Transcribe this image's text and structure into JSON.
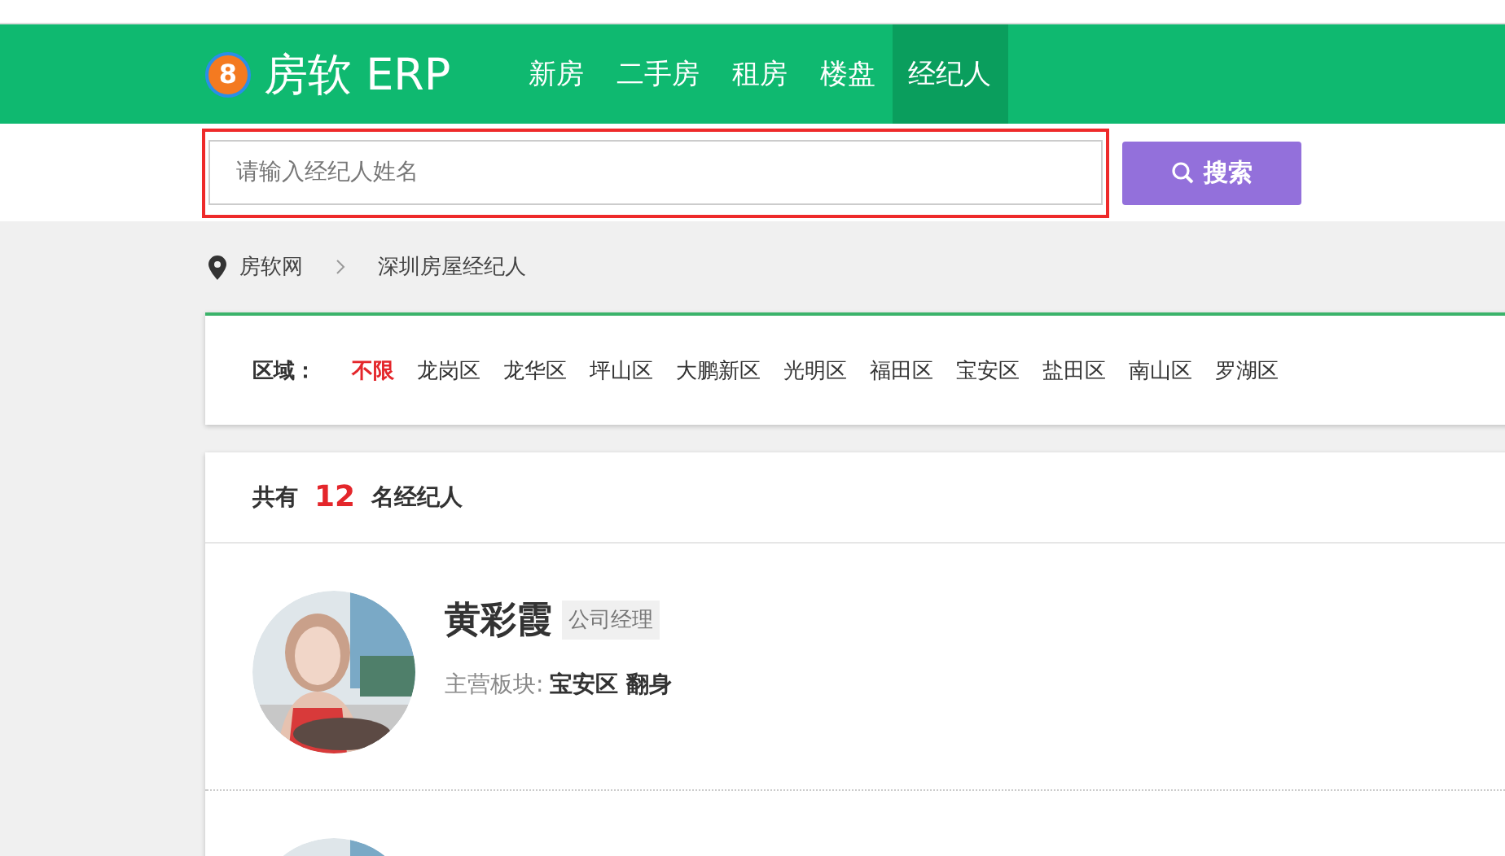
{
  "header": {
    "logo_badge": "8",
    "logo_text": "房软 ERP",
    "nav": [
      {
        "label": "新房",
        "selected": false
      },
      {
        "label": "二手房",
        "selected": false
      },
      {
        "label": "租房",
        "selected": false
      },
      {
        "label": "楼盘",
        "selected": false
      },
      {
        "label": "经纪人",
        "selected": true
      }
    ]
  },
  "search": {
    "placeholder": "请输入经纪人姓名",
    "highlighted": true,
    "button": "搜索"
  },
  "breadcrumb": [
    "房软网",
    "深圳房屋经纪人"
  ],
  "filter": {
    "label": "区域：",
    "options": [
      {
        "label": "不限",
        "selected": true
      },
      {
        "label": "龙岗区",
        "selected": false
      },
      {
        "label": "龙华区",
        "selected": false
      },
      {
        "label": "坪山区",
        "selected": false
      },
      {
        "label": "大鹏新区",
        "selected": false
      },
      {
        "label": "光明区",
        "selected": false
      },
      {
        "label": "福田区",
        "selected": false
      },
      {
        "label": "宝安区",
        "selected": false
      },
      {
        "label": "盐田区",
        "selected": false
      },
      {
        "label": "南山区",
        "selected": false
      },
      {
        "label": "罗湖区",
        "selected": false
      }
    ]
  },
  "count": {
    "prefix": "共有",
    "number": "12",
    "suffix": "名经纪人"
  },
  "agents": [
    {
      "name": "黄彩霞",
      "title": "公司经理",
      "area_label": "主营板块:",
      "areas": "宝安区 翻身"
    },
    {
      "kind": "picture"
    }
  ]
}
